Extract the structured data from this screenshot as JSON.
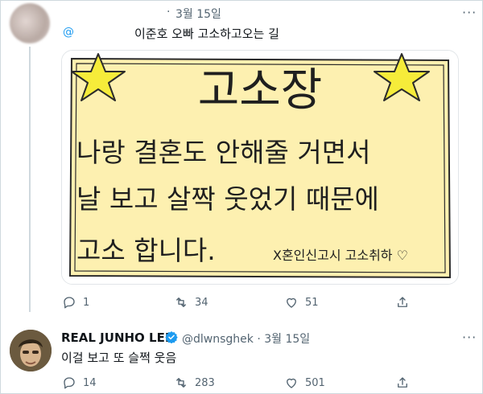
{
  "tweet1": {
    "separator": "·",
    "date": "3월 15일",
    "menu": "···",
    "mention": "@",
    "text": "이준호 오빠 고소하고오는 길",
    "image": {
      "title": "고소장",
      "lines": [
        "나랑 결혼도 안해줄 거면서",
        "날 보고 살짝 웃었기 때문에",
        "고소 합니다."
      ],
      "signature": "X혼인신고시 고소취하 ♡"
    },
    "actions": {
      "reply_count": "1",
      "retweet_count": "34",
      "like_count": "51"
    }
  },
  "tweet2": {
    "name": "REAL JUNHO LEE",
    "handle_date": "@dlwnsghek · 3월 15일",
    "text": "이걸 보고 또 슬쩍 웃음",
    "actions": {
      "reply_count": "14",
      "retweet_count": "283",
      "like_count": "501"
    }
  },
  "colors": {
    "accent": "#1d9bf0",
    "muted": "#536471",
    "paper": "#fdf0b0",
    "star": "#f6ec3a"
  }
}
